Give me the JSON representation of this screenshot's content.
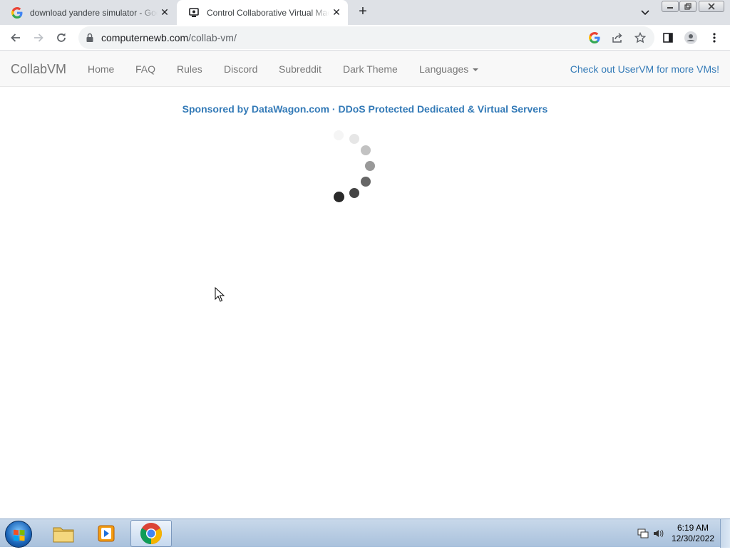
{
  "browser": {
    "tabs": [
      {
        "title": "download yandere simulator - Goo",
        "icon": "google-g-icon"
      },
      {
        "title": "Control Collaborative Virtual Mac",
        "icon": "collabvm-icon"
      }
    ],
    "url_host": "computernewb.com",
    "url_path": "/collab-vm/"
  },
  "site": {
    "brand": "CollabVM",
    "nav": [
      "Home",
      "FAQ",
      "Rules",
      "Discord",
      "Subreddit",
      "Dark Theme",
      "Languages"
    ],
    "right_link": "Check out UserVM for more VMs!",
    "sponsor": "Sponsored by DataWagon.com · DDoS Protected Dedicated & Virtual Servers"
  },
  "taskbar": {
    "time": "6:19 AM",
    "date": "12/30/2022"
  },
  "colors": {
    "link": "#337ab7",
    "navbar_bg": "#f8f8f8",
    "tabstrip_bg": "#dee1e6"
  }
}
